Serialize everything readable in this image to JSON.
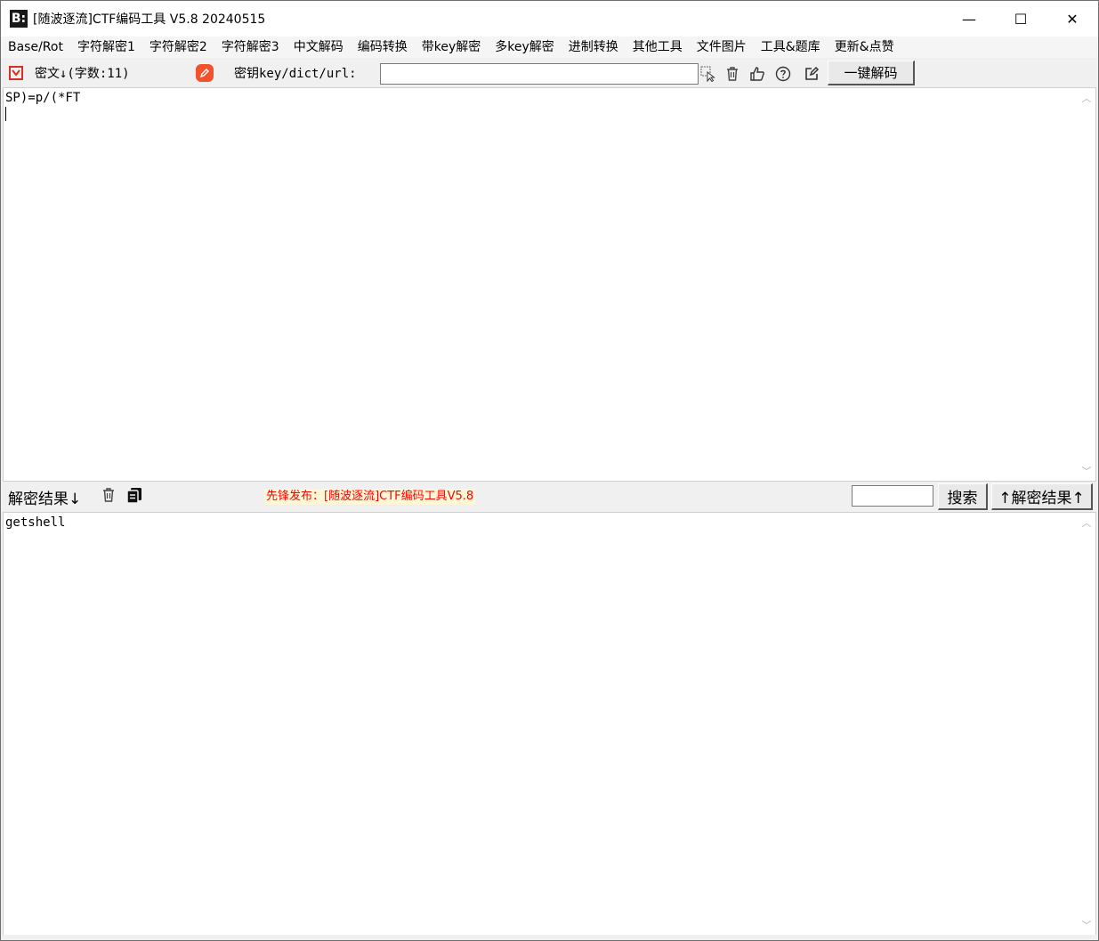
{
  "window": {
    "title": "[随波逐流]CTF编码工具 V5.8 20240515",
    "logo_text": "B:",
    "minimize": "—",
    "maximize": "☐",
    "close": "✕"
  },
  "menu": {
    "items": [
      "Base/Rot",
      "字符解密1",
      "字符解密2",
      "字符解密3",
      "中文解码",
      "编码转换",
      "带key解密",
      "多key解密",
      "进制转换",
      "其他工具",
      "文件图片",
      "工具&题库",
      "更新&点赞"
    ]
  },
  "cipher_toolbar": {
    "label": "密文↓(字数:11)",
    "key_label": "密钥key/dict/url:",
    "key_value": "",
    "one_click_decode": "一键解码"
  },
  "cipher": {
    "text": "SP)=p/(*FT"
  },
  "result_toolbar": {
    "label": "解密结果↓",
    "promo": "先锋发布：[随波逐流]CTF编码工具V5.8",
    "search_value": "",
    "search_button": "搜索",
    "result_up_button": "↑解密结果↑"
  },
  "result": {
    "text": "getshell"
  },
  "icons": {
    "app": "logo-icon",
    "import": "import-icon",
    "edit": "edit-badge-icon",
    "select": "pointer-icon",
    "trash": "trash-icon",
    "like": "thumbs-up-icon",
    "help": "help-icon",
    "note": "edit-icon",
    "copy": "copy-icon"
  }
}
